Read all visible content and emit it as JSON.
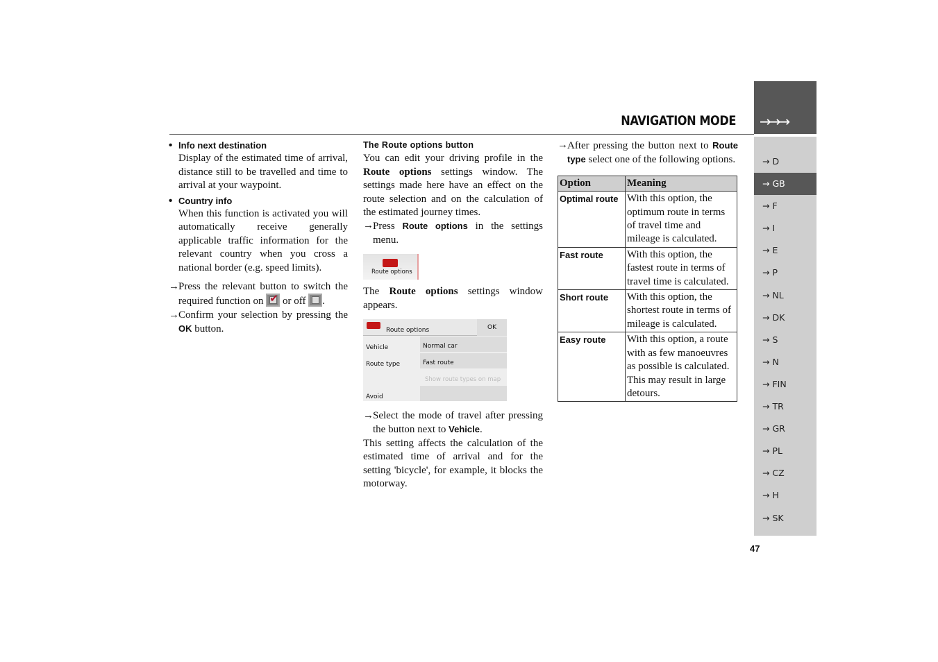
{
  "header": {
    "title": "NAVIGATION MODE",
    "arrows": "→→→",
    "page_number": "47"
  },
  "sidebar": {
    "items": [
      {
        "label": "→ D"
      },
      {
        "label": "→ GB",
        "selected": true
      },
      {
        "label": "→ F"
      },
      {
        "label": "→ I"
      },
      {
        "label": "→ E"
      },
      {
        "label": "→ P"
      },
      {
        "label": "→ NL"
      },
      {
        "label": "→ DK"
      },
      {
        "label": "→ S"
      },
      {
        "label": "→ N"
      },
      {
        "label": "→ FIN"
      },
      {
        "label": "→ TR"
      },
      {
        "label": "→ GR"
      },
      {
        "label": "→ PL"
      },
      {
        "label": "→ CZ"
      },
      {
        "label": "→ H"
      },
      {
        "label": "→ SK"
      }
    ]
  },
  "col1": {
    "b1_title": "Info next destination",
    "b1_text": "Display of the estimated time of arrival, distance still to be travelled and time to arrival at your waypoint.",
    "b2_title": "Country info",
    "b2_text": "When this function is activated you will automatically receive generally applicable traffic information for the relevant country when you cross a national border (e.g. speed limits).",
    "s1_a": "Press the relevant button to switch the required function on",
    "s1_b": "or off",
    "s1_c": ".",
    "s2_a": "Confirm your selection by pressing the",
    "s2_ok": "OK",
    "s2_b": "button."
  },
  "col2": {
    "heading": "The Route options button",
    "p1_a": "You can edit your driving profile in the",
    "p1_bold": "Route options",
    "p1_b": "settings window. The settings made here have an effect on the route selection and on the calculation of the estimated journey times.",
    "s1_a": "Press",
    "s1_bold": "Route options",
    "s1_b": "in the settings menu.",
    "button_label": "Route options",
    "p2_a": "The",
    "p2_bold": "Route options",
    "p2_b": "settings window appears.",
    "window": {
      "title": "Route options",
      "ok": "OK",
      "vehicle_label": "Vehicle",
      "vehicle_value": "Normal car",
      "route_type_label": "Route type",
      "route_type_value": "Fast route",
      "show_types": "Show route types on map",
      "avoid_label": "Avoid"
    },
    "s2_a": "Select the mode of travel after pressing the button next to",
    "s2_bold": "Vehicle",
    "s2_b": ".",
    "p3": "This setting affects the calculation of the estimated time of arrival and for the setting 'bicycle', for example, it blocks the motorway."
  },
  "col3": {
    "s1_a": "After pressing the button next to",
    "s1_bold": "Route type",
    "s1_b": "select one of the following options.",
    "table": {
      "headers": [
        "Option",
        "Meaning"
      ],
      "rows": [
        [
          "Optimal route",
          "With this option, the optimum route in terms of travel time and mileage is calculated."
        ],
        [
          "Fast route",
          "With this option, the fastest route in terms of travel time is calculated."
        ],
        [
          "Short route",
          "With this option, the shortest route in terms of mileage is calculated."
        ],
        [
          "Easy route",
          "With this option, a route with as few manoeuvres as possible is calculated. This may result in large detours."
        ]
      ]
    }
  }
}
